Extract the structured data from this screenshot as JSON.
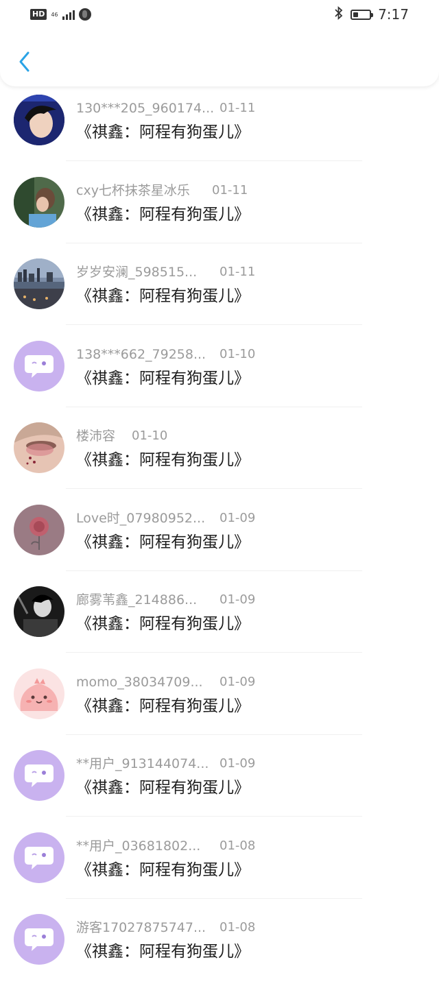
{
  "status_bar": {
    "hd": "HD",
    "network": "46",
    "time": "7:17"
  },
  "header": {
    "back_icon": "chevron-left-icon"
  },
  "colors": {
    "accent": "#2aa3e6",
    "default_avatar_bg": "#c9b2ef"
  },
  "comments": [
    {
      "user": "130***205_960174...",
      "date": "01-11",
      "title": "《祺鑫：阿程有狗蛋儿》",
      "avatar": "photo-portrait"
    },
    {
      "user": "cxy七杯抹茶星冰乐",
      "date": "01-11",
      "title": "《祺鑫：阿程有狗蛋儿》",
      "avatar": "photo-person"
    },
    {
      "user": "岁岁安澜_598515...",
      "date": "01-11",
      "title": "《祺鑫：阿程有狗蛋儿》",
      "avatar": "photo-cityscape"
    },
    {
      "user": "138***662_79258...",
      "date": "01-10",
      "title": "《祺鑫：阿程有狗蛋儿》",
      "avatar": "default-chat-bubble"
    },
    {
      "user": "楼沛容",
      "date": "01-10",
      "title": "《祺鑫：阿程有狗蛋儿》",
      "avatar": "photo-makeup"
    },
    {
      "user": "Love时_07980952...",
      "date": "01-09",
      "title": "《祺鑫：阿程有狗蛋儿》",
      "avatar": "photo-rose"
    },
    {
      "user": "廊雾苇鑫_214886...",
      "date": "01-09",
      "title": "《祺鑫：阿程有狗蛋儿》",
      "avatar": "photo-monochrome"
    },
    {
      "user": "momo_38034709...",
      "date": "01-09",
      "title": "《祺鑫：阿程有狗蛋儿》",
      "avatar": "cartoon-pink"
    },
    {
      "user": "**用户_913144074...",
      "date": "01-09",
      "title": "《祺鑫：阿程有狗蛋儿》",
      "avatar": "default-chat-bubble"
    },
    {
      "user": "**用户_03681802...",
      "date": "01-08",
      "title": "《祺鑫：阿程有狗蛋儿》",
      "avatar": "default-chat-bubble"
    },
    {
      "user": "游客17027875747...",
      "date": "01-08",
      "title": "《祺鑫：阿程有狗蛋儿》",
      "avatar": "default-chat-bubble"
    }
  ]
}
